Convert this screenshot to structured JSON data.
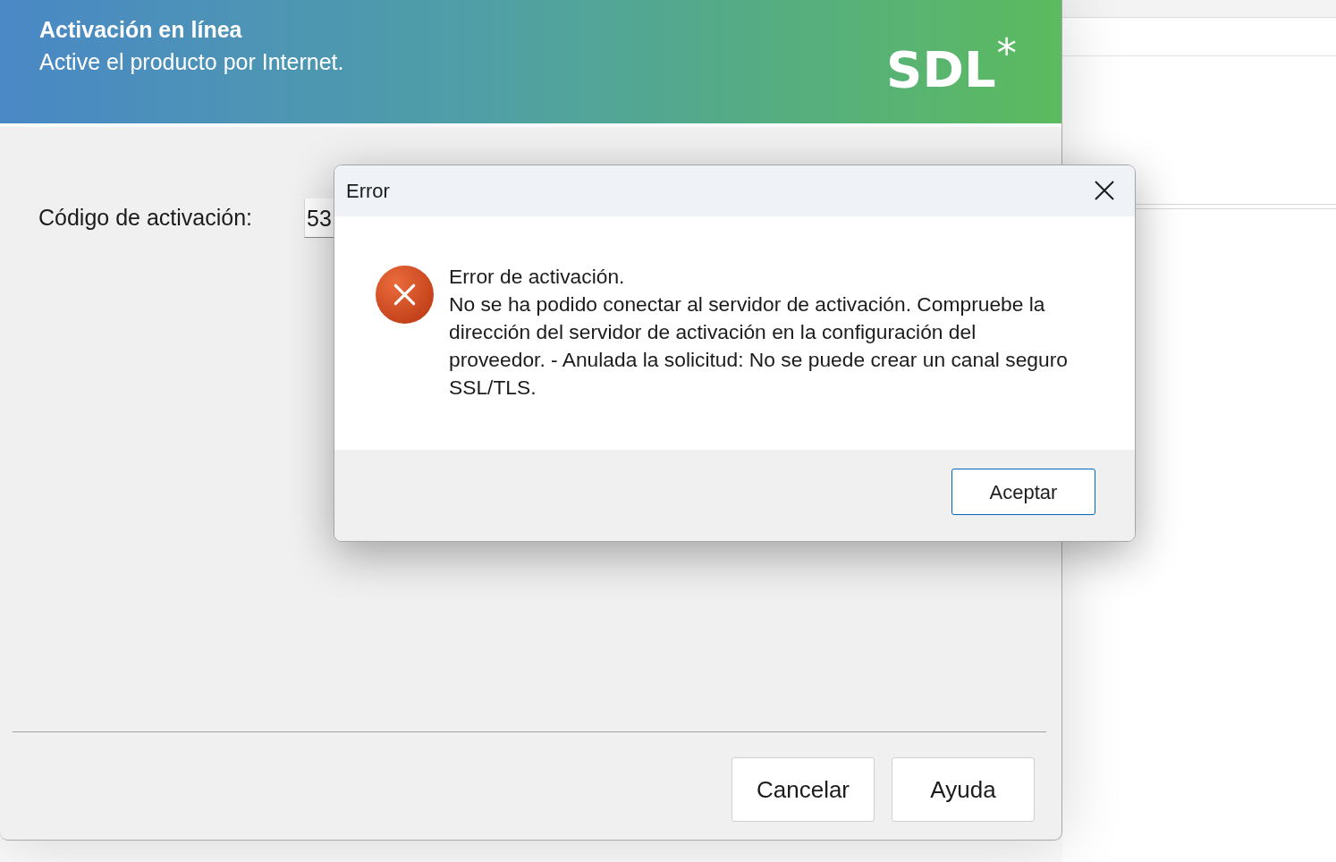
{
  "window": {
    "title": "Activación en línea",
    "subtitle": "Active el producto por Internet.",
    "logo": "SDL$^{*}$"
  },
  "form": {
    "label": "Código de activación:",
    "value": "53"
  },
  "dialog": {
    "title": "Error",
    "heading": "Error de activación.",
    "message": "No se ha podido conectar al servidor de activación. Compruebe la dirección del servidor de activación en la configuración del proveedor. - Anulada la solicitud: No se puede crear un canal seguro SSL/TLS.",
    "buttons": [
      {
        "label": "Aceptar",
        "default": true
      }
    ]
  },
  "buttons": [
    {
      "label": "Cancelar",
      "default": false
    },
    {
      "label": "Ayuda",
      "default": false
    }
  ]
}
